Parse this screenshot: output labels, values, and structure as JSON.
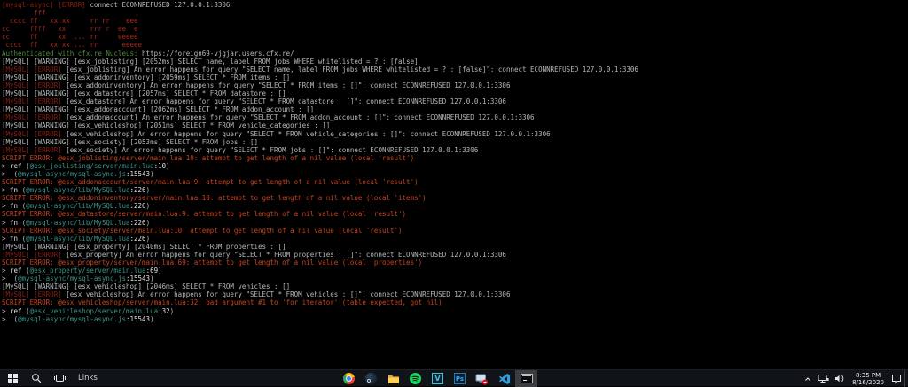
{
  "palette": {
    "console_bg": "#000000",
    "text_gray": "#b9b9b9",
    "mysql_error_maroon": "#8b1f10",
    "logo_red": "#a8291c",
    "auth_green": "#4e8b36",
    "script_error_orange": "#c8431f",
    "stack_path_teal": "#3b9489",
    "taskbar_bg": "#101317",
    "active_app_bg": "#3a3d40"
  },
  "console": {
    "lines": [
      [
        [
          "maroon",
          "[mysql-async] [ERROR] "
        ],
        [
          "gray",
          "connect ECONNREFUSED 127.0.0.1:3306"
        ]
      ],
      [
        [
          "red",
          "        fff"
        ]
      ],
      [
        [
          "red",
          "  cccc ff   xx xx     rr rr    eee"
        ]
      ],
      [
        [
          "red",
          "cc     ffff   xx      rrr r  ee  e"
        ]
      ],
      [
        [
          "red",
          "cc     ff     xx  ... rr     eeeee"
        ]
      ],
      [
        [
          "red",
          " cccc  ff   xx xx ... rr      eeeee"
        ]
      ],
      [
        [
          "green",
          "Authenticated with cfx.re Nucleus: "
        ],
        [
          "gray",
          "https://foreign69-vjgjar.users.cfx.re/"
        ]
      ],
      [
        [
          "gray",
          "[MySQL] [WARNING] [esx_joblisting] [2052ms] SELECT name, label FROM jobs WHERE whitelisted = ? : [false]"
        ]
      ],
      [
        [
          "maroon",
          "[MySQL] [ERROR] "
        ],
        [
          "gray",
          "[esx_joblisting] An error happens for query \"SELECT name, label FROM jobs WHERE whitelisted = ? : [false]\": connect ECONNREFUSED 127.0.0.1:3306"
        ]
      ],
      [
        [
          "gray",
          "[MySQL] [WARNING] [esx_addoninventory] [2059ms] SELECT * FROM items : []"
        ]
      ],
      [
        [
          "maroon",
          "[MySQL] [ERROR] "
        ],
        [
          "gray",
          "[esx_addoninventory] An error happens for query \"SELECT * FROM items : []\": connect ECONNREFUSED 127.0.0.1:3306"
        ]
      ],
      [
        [
          "gray",
          "[MySQL] [WARNING] [esx_datastore] [2057ms] SELECT * FROM datastore : []"
        ]
      ],
      [
        [
          "maroon",
          "[MySQL] [ERROR] "
        ],
        [
          "gray",
          "[esx_datastore] An error happens for query \"SELECT * FROM datastore : []\": connect ECONNREFUSED 127.0.0.1:3306"
        ]
      ],
      [
        [
          "gray",
          "[MySQL] [WARNING] [esx_addonaccount] [2062ms] SELECT * FROM addon_account : []"
        ]
      ],
      [
        [
          "maroon",
          "[MySQL] [ERROR] "
        ],
        [
          "gray",
          "[esx_addonaccount] An error happens for query \"SELECT * FROM addon_account : []\": connect ECONNREFUSED 127.0.0.1:3306"
        ]
      ],
      [
        [
          "gray",
          "[MySQL] [WARNING] [esx_vehicleshop] [2051ms] SELECT * FROM vehicle_categories : []"
        ]
      ],
      [
        [
          "maroon",
          "[MySQL] [ERROR] "
        ],
        [
          "gray",
          "[esx_vehicleshop] An error happens for query \"SELECT * FROM vehicle_categories : []\": connect ECONNREFUSED 127.0.0.1:3306"
        ]
      ],
      [
        [
          "gray",
          "[MySQL] [WARNING] [esx_society] [2053ms] SELECT * FROM jobs : []"
        ]
      ],
      [
        [
          "maroon",
          "[MySQL] [ERROR] "
        ],
        [
          "gray",
          "[esx_society] An error happens for query \"SELECT * FROM jobs : []\": connect ECONNREFUSED 127.0.0.1:3306"
        ]
      ],
      [
        [
          "orange",
          "SCRIPT ERROR: @esx_joblisting/server/main.lua:10: attempt to get length of a nil value (local 'result')"
        ]
      ],
      [
        [
          "gray",
          "> "
        ],
        [
          "white",
          "ref "
        ],
        [
          "gray",
          "("
        ],
        [
          "teal",
          "@esx_joblisting/server/main.lua"
        ],
        [
          "white",
          ":10"
        ],
        [
          "gray",
          ")"
        ]
      ],
      [
        [
          "gray",
          ">  ("
        ],
        [
          "teal",
          "@mysql-async/mysql-async.js"
        ],
        [
          "white",
          ":15543"
        ],
        [
          "gray",
          ")"
        ]
      ],
      [
        [
          "orange",
          "SCRIPT ERROR: @esx_addonaccount/server/main.lua:9: attempt to get length of a nil value (local 'result')"
        ]
      ],
      [
        [
          "gray",
          "> "
        ],
        [
          "white",
          "fn "
        ],
        [
          "gray",
          "("
        ],
        [
          "teal",
          "@mysql-async/lib/MySQL.lua"
        ],
        [
          "white",
          ":226"
        ],
        [
          "gray",
          ")"
        ]
      ],
      [
        [
          "orange",
          "SCRIPT ERROR: @esx_addoninventory/server/main.lua:10: attempt to get length of a nil value (local 'items')"
        ]
      ],
      [
        [
          "gray",
          "> "
        ],
        [
          "white",
          "fn "
        ],
        [
          "gray",
          "("
        ],
        [
          "teal",
          "@mysql-async/lib/MySQL.lua"
        ],
        [
          "white",
          ":226"
        ],
        [
          "gray",
          ")"
        ]
      ],
      [
        [
          "orange",
          "SCRIPT ERROR: @esx_datastore/server/main.lua:9: attempt to get length of a nil value (local 'result')"
        ]
      ],
      [
        [
          "gray",
          "> "
        ],
        [
          "white",
          "fn "
        ],
        [
          "gray",
          "("
        ],
        [
          "teal",
          "@mysql-async/lib/MySQL.lua"
        ],
        [
          "white",
          ":226"
        ],
        [
          "gray",
          ")"
        ]
      ],
      [
        [
          "orange",
          "SCRIPT ERROR: @esx_society/server/main.lua:10: attempt to get length of a nil value (local 'result')"
        ]
      ],
      [
        [
          "gray",
          "> "
        ],
        [
          "white",
          "fn "
        ],
        [
          "gray",
          "("
        ],
        [
          "teal",
          "@mysql-async/lib/MySQL.lua"
        ],
        [
          "white",
          ":226"
        ],
        [
          "gray",
          ")"
        ]
      ],
      [
        [
          "gray",
          "[MySQL] [WARNING] [esx_property] [2040ms] SELECT * FROM properties : []"
        ]
      ],
      [
        [
          "maroon",
          "[MySQL] [ERROR] "
        ],
        [
          "gray",
          "[esx_property] An error happens for query \"SELECT * FROM properties : []\": connect ECONNREFUSED 127.0.0.1:3306"
        ]
      ],
      [
        [
          "orange",
          "SCRIPT ERROR: @esx_property/server/main.lua:69: attempt to get length of a nil value (local 'properties')"
        ]
      ],
      [
        [
          "gray",
          "> "
        ],
        [
          "white",
          "ref "
        ],
        [
          "gray",
          "("
        ],
        [
          "teal",
          "@esx_property/server/main.lua"
        ],
        [
          "white",
          ":69"
        ],
        [
          "gray",
          ")"
        ]
      ],
      [
        [
          "gray",
          ">  ("
        ],
        [
          "teal",
          "@mysql-async/mysql-async.js"
        ],
        [
          "white",
          ":15543"
        ],
        [
          "gray",
          ")"
        ]
      ],
      [
        [
          "gray",
          "[MySQL] [WARNING] [esx_vehicleshop] [2046ms] SELECT * FROM vehicles : []"
        ]
      ],
      [
        [
          "maroon",
          "[MySQL] [ERROR] "
        ],
        [
          "gray",
          "[esx_vehicleshop] An error happens for query \"SELECT * FROM vehicles : []\": connect ECONNREFUSED 127.0.0.1:3306"
        ]
      ],
      [
        [
          "orange",
          "SCRIPT ERROR: @esx_vehicleshop/server/main.lua:32: bad argument #1 to 'for iterator' (table expected, got nil)"
        ]
      ],
      [
        [
          "gray",
          "> "
        ],
        [
          "white",
          "ref "
        ],
        [
          "gray",
          "("
        ],
        [
          "teal",
          "@esx_vehicleshop/server/main.lua"
        ],
        [
          "white",
          ":32"
        ],
        [
          "gray",
          ")"
        ]
      ],
      [
        [
          "gray",
          ">  ("
        ],
        [
          "teal",
          "@mysql-async/mysql-async.js"
        ],
        [
          "white",
          ":15543"
        ],
        [
          "gray",
          ")"
        ]
      ]
    ]
  },
  "taskbar": {
    "links_label": "Links",
    "tray": {
      "time": "8:35 PM",
      "date": "8/16/2020"
    }
  }
}
